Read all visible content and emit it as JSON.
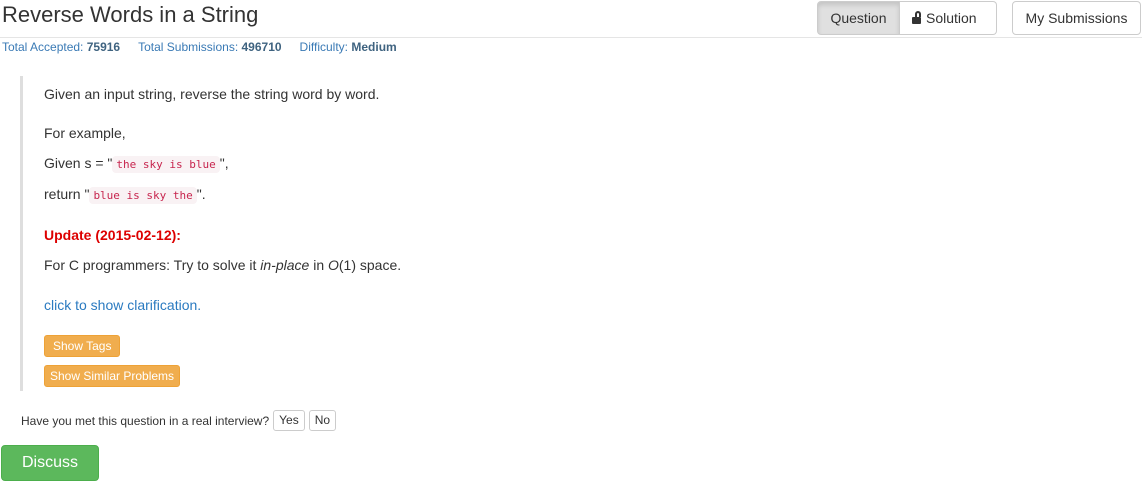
{
  "header": {
    "title": "Reverse Words in a String",
    "question_label": "Question",
    "solution_label": "Solution",
    "submissions_label": "My Submissions"
  },
  "stats": {
    "accepted_label": "Total Accepted:",
    "accepted_value": "75916",
    "submissions_label": "Total Submissions:",
    "submissions_value": "496710",
    "difficulty_label": "Difficulty:",
    "difficulty_value": "Medium"
  },
  "problem": {
    "description": "Given an input string, reverse the string word by word.",
    "example_intro": "For example,",
    "given_prefix": "Given s = \"",
    "given_code": "the sky is blue",
    "given_suffix": "\",",
    "return_prefix": "return \"",
    "return_code": "blue is sky the",
    "return_suffix": "\".",
    "update_heading": "Update (2015-02-12):",
    "update_text_1": "For C programmers: Try to solve it ",
    "update_text_em": "in-place",
    "update_text_2": " in ",
    "update_text_o": "O",
    "update_text_3": "(1) space.",
    "clarification_link": "click to show clarification.",
    "show_tags_label": "Show Tags",
    "show_similar_label": "Show Similar Problems"
  },
  "interview": {
    "question": "Have you met this question in a real interview?",
    "yes_label": "Yes",
    "no_label": "No"
  },
  "discuss_label": "Discuss",
  "colors": {
    "accent_link": "#2a7ac0",
    "update_red": "#dd0000",
    "warning_button": "#f0ad4e",
    "success_button": "#5cb85c",
    "code_text": "#c7254e"
  }
}
